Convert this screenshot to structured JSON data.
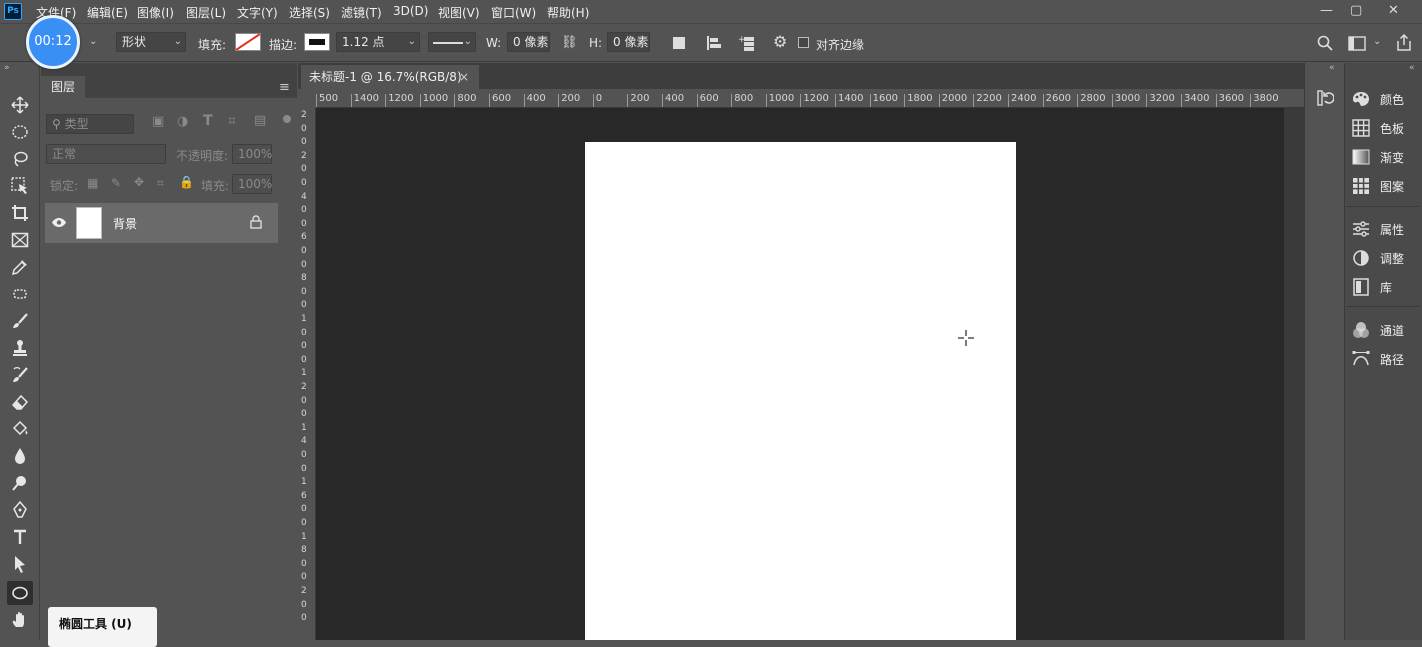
{
  "app": {
    "logo": "Ps",
    "accent": "#31a8ff"
  },
  "menu": [
    "文件(F)",
    "编辑(E)",
    "图像(I)",
    "图层(L)",
    "文字(Y)",
    "选择(S)",
    "滤镜(T)",
    "3D(D)",
    "视图(V)",
    "窗口(W)",
    "帮助(H)"
  ],
  "window": {
    "minimize": "—",
    "restore": "▢",
    "close": "✕"
  },
  "timer": "00:12",
  "options": {
    "mode": "形状",
    "fill_label": "填充:",
    "stroke_label": "描边:",
    "stroke_width": "1.12 点",
    "w_label": "W:",
    "w_value": "0 像素",
    "h_label": "H:",
    "h_value": "0 像素",
    "align_edges": "对齐边缘"
  },
  "layers": {
    "tab": "图层",
    "search_placeholder": "类型",
    "blend_mode": "正常",
    "opacity_label": "不透明度:",
    "opacity_value": "100%",
    "lock_label": "锁定:",
    "fill_label": "填充:",
    "fill_value": "100%",
    "items": [
      {
        "name": "背景",
        "locked": true,
        "visible": true
      }
    ]
  },
  "document": {
    "tab": "未标题-1 @ 16.7%(RGB/8)",
    "close": "×"
  },
  "rulers": {
    "horizontal": [
      "500",
      "1400",
      "1200",
      "1000",
      "800",
      "600",
      "400",
      "200",
      "0",
      "200",
      "400",
      "600",
      "800",
      "1000",
      "1200",
      "1400",
      "1600",
      "1800",
      "2000",
      "2200",
      "2400",
      "2600",
      "2800",
      "3000",
      "3200",
      "3400",
      "3600",
      "3800"
    ],
    "vertical": [
      "2",
      "0",
      "0",
      "2",
      "0",
      "0",
      "4",
      "0",
      "0",
      "6",
      "0",
      "0",
      "8",
      "0",
      "0",
      "1",
      "0",
      "0",
      "0",
      "1",
      "2",
      "0",
      "0",
      "1",
      "4",
      "0",
      "0",
      "1",
      "6",
      "0",
      "0",
      "1",
      "8",
      "0",
      "0",
      "2",
      "0",
      "0"
    ]
  },
  "right_panels": {
    "group1": [
      {
        "label": "颜色",
        "icon": "palette-icon"
      },
      {
        "label": "色板",
        "icon": "swatches-icon"
      },
      {
        "label": "渐变",
        "icon": "gradient-icon"
      },
      {
        "label": "图案",
        "icon": "pattern-icon"
      }
    ],
    "group2": [
      {
        "label": "属性",
        "icon": "properties-icon"
      },
      {
        "label": "调整",
        "icon": "adjustments-icon"
      },
      {
        "label": "库",
        "icon": "libraries-icon"
      }
    ],
    "group3": [
      {
        "label": "通道",
        "icon": "channels-icon"
      },
      {
        "label": "路径",
        "icon": "paths-icon"
      }
    ]
  },
  "tooltip": {
    "title": "椭圆工具 (U)"
  },
  "annotation_color": "#e0301e"
}
